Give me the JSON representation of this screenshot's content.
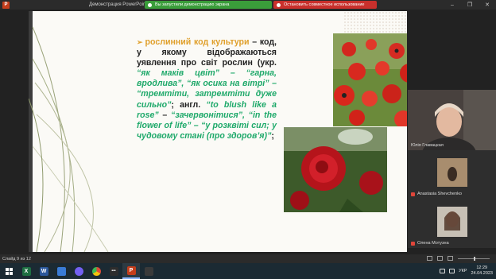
{
  "window": {
    "title": "Демонстрация PowerPoint",
    "app_icon_letter": "P",
    "sharing_banner": "Вы запустили демонстрацию экрана",
    "stop_sharing_button": "Остановить совместное использование",
    "controls": [
      "–",
      "❐",
      "✕"
    ]
  },
  "slide": {
    "bullet": "➢",
    "text": {
      "term": "рослинний код культури",
      "dash1": " – код, у якому відображаються уявлення про світ рослин (укр. ",
      "ukr_examples": "“як маків цвіт” – “гарна, вродлива”, “як осика на вітрі” – “тремтіти, затремтіти дуже сильно”",
      "sep": "; англ. ",
      "eng_example": "“to blush like a rose”",
      "dash2": " – ",
      "eng_translation": "“зачервонітися”, “in the flower of life” – “у розквіті сил; у чудовому стані (про здоров’я)”",
      "end": ";"
    },
    "photos": [
      "poppies",
      "red-roses"
    ]
  },
  "participants": [
    {
      "name": "Юлія Главацкая",
      "mic_muted": false
    },
    {
      "name": "Anastasia Shevchenko",
      "mic_muted": true
    },
    {
      "name": "Олена Мотузна",
      "mic_muted": true
    }
  ],
  "statusbar": {
    "slide_counter": "Слайд 9 из 12"
  },
  "taskbar": {
    "apps": [
      {
        "id": "excel",
        "letter": "X",
        "color": "#1d6f42"
      },
      {
        "id": "word",
        "letter": "W",
        "color": "#2b579a"
      },
      {
        "id": "files",
        "letter": "",
        "color": "#3a7bd5"
      },
      {
        "id": "viber",
        "letter": "",
        "color": "#7360f2"
      },
      {
        "id": "chrome",
        "letter": "",
        "color": "#dd4b39"
      },
      {
        "id": "dots",
        "letter": "•••",
        "color": "#2d2d2d"
      },
      {
        "id": "powerpoint",
        "letter": "P",
        "color": "#c43e1c"
      },
      {
        "id": "store",
        "letter": "",
        "color": "#3a3a3a"
      }
    ],
    "language": "УКР",
    "time": "12:29",
    "date": "24.04.2023"
  },
  "colors": {
    "accent_gold": "#e0a02c",
    "accent_green": "#1ea96a",
    "share_green": "#3a9d3a",
    "stop_red": "#c9302c"
  }
}
